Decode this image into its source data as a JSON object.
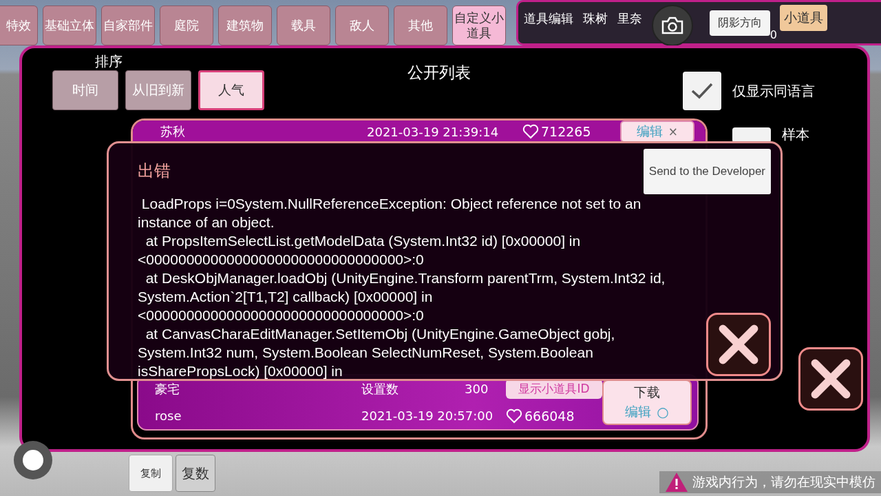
{
  "category_tabs": [
    {
      "label": "特效",
      "selected": false
    },
    {
      "label": "基础立体",
      "selected": false
    },
    {
      "label": "自家部件",
      "selected": false
    },
    {
      "label": "庭院",
      "selected": false
    },
    {
      "label": "建筑物",
      "selected": false
    },
    {
      "label": "载具",
      "selected": false
    },
    {
      "label": "敌人",
      "selected": false
    },
    {
      "label": "其他",
      "selected": false
    },
    {
      "label": "自定义小道具",
      "selected": true
    }
  ],
  "edit_panel": {
    "title": "道具编辑",
    "names": [
      "珠树",
      "里奈"
    ],
    "shadow_button": "阴影方向",
    "shadow_value": "0",
    "props_button": "小道具"
  },
  "public_list": {
    "sort_label": "排序",
    "sort_options": [
      {
        "label": "时间",
        "selected": false
      },
      {
        "label": "从旧到新",
        "selected": false
      },
      {
        "label": "人气",
        "selected": true
      }
    ],
    "title": "公开列表",
    "filters": [
      {
        "label": "仅显示同语言",
        "checked": true
      },
      {
        "label": "样本",
        "checked": false
      }
    ],
    "rows": [
      {
        "kind": "partial",
        "author": "苏秋",
        "date": "2021-03-19 21:39:14",
        "likes": "712265",
        "edit": "编辑",
        "mark": "×"
      },
      {
        "kind": "full",
        "title": "豪宅",
        "count_label": "设置数",
        "count": "300",
        "id_button": "显示小道具ID",
        "download": "下载",
        "author": "rose",
        "date": "2021-03-19 20:57:00",
        "likes": "666048",
        "edit": "编辑",
        "mark": "○"
      }
    ]
  },
  "error_dialog": {
    "title": "出错",
    "send_button": "Send to the Developer",
    "message": " LoadProps i=0System.NullReferenceException: Object reference not set to an instance of an object.\n  at PropsItemSelectList.getModelData (System.Int32 id) [0x00000] in <00000000000000000000000000000000>:0\n  at DeskObjManager.loadObj (UnityEngine.Transform parentTrm, System.Int32 id, System.Action`2[T1,T2] callback) [0x00000] in <00000000000000000000000000000000>:0\n  at CanvasCharaEditManager.SetItemObj (UnityEngine.GameObject gobj, System.Int32 num, System.Boolean SelectNumReset, System.Boolean isSharePropsLock) [0x00000] in"
  },
  "bottom": {
    "copy_button": "复制",
    "multiple_button": "复数",
    "warning": "游戏内行为，请勿在现实中模仿"
  }
}
